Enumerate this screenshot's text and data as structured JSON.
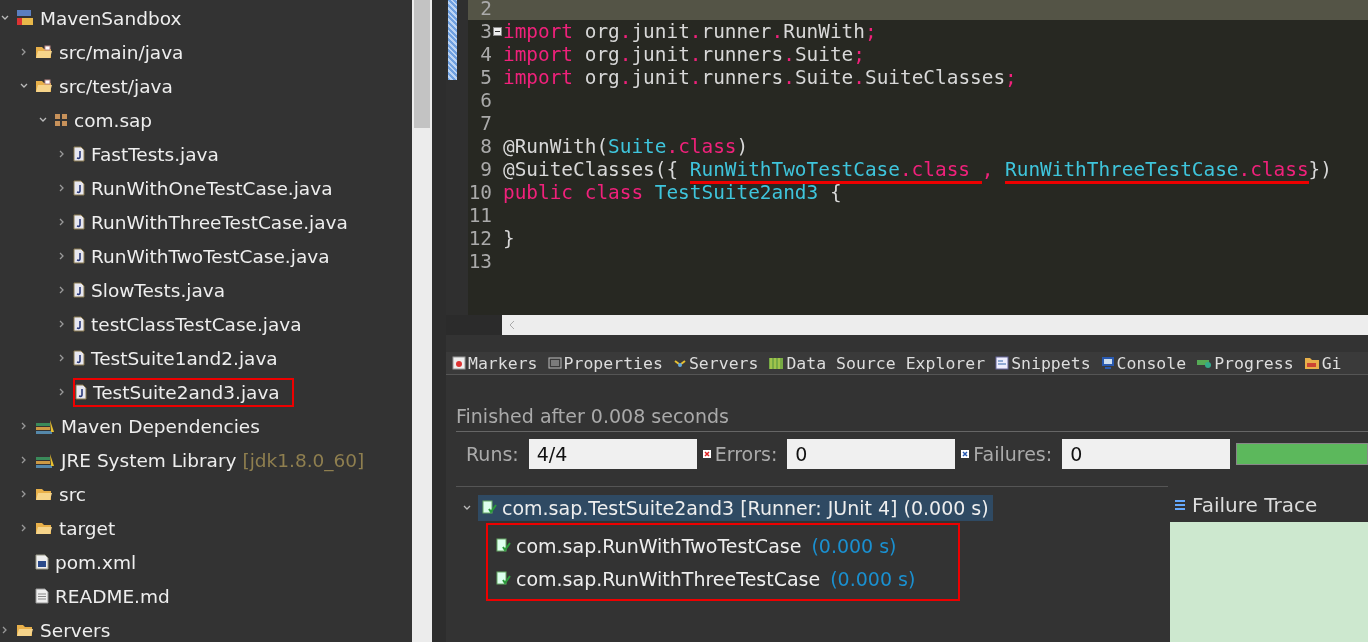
{
  "project_explorer": {
    "items": [
      {
        "label": "MavenSandbox",
        "kind": "project",
        "expanded": true,
        "children": [
          {
            "label": "src/main/java",
            "kind": "source-folder",
            "expanded": false
          },
          {
            "label": "src/test/java",
            "kind": "source-folder",
            "expanded": true,
            "children": [
              {
                "label": "com.sap",
                "kind": "package",
                "expanded": true,
                "children": [
                  {
                    "label": "FastTests.java",
                    "kind": "java-file",
                    "expanded": false,
                    "outlined": false
                  },
                  {
                    "label": "RunWithOneTestCase.java",
                    "kind": "java-file",
                    "expanded": false,
                    "outlined": false
                  },
                  {
                    "label": "RunWithThreeTestCase.java",
                    "kind": "java-file",
                    "expanded": false,
                    "outlined": false
                  },
                  {
                    "label": "RunWithTwoTestCase.java",
                    "kind": "java-file",
                    "expanded": false,
                    "outlined": false
                  },
                  {
                    "label": "SlowTests.java",
                    "kind": "java-file",
                    "expanded": false,
                    "outlined": false
                  },
                  {
                    "label": "testClassTestCase.java",
                    "kind": "java-file",
                    "expanded": false,
                    "outlined": false
                  },
                  {
                    "label": "TestSuite1and2.java",
                    "kind": "java-file",
                    "expanded": false,
                    "outlined": false
                  },
                  {
                    "label": "TestSuite2and3.java",
                    "kind": "java-file",
                    "expanded": false,
                    "outlined": true
                  }
                ]
              }
            ]
          },
          {
            "label": "Maven Dependencies",
            "kind": "library",
            "expanded": false
          },
          {
            "label": "JRE System Library",
            "decoration": "[jdk1.8.0_60]",
            "kind": "library",
            "expanded": false
          },
          {
            "label": "src",
            "kind": "folder",
            "expanded": false
          },
          {
            "label": "target",
            "kind": "folder",
            "expanded": false
          },
          {
            "label": "pom.xml",
            "kind": "xml-file"
          },
          {
            "label": "README.md",
            "kind": "text-file"
          }
        ]
      },
      {
        "label": "Servers",
        "kind": "folder",
        "expanded": false
      }
    ]
  },
  "editor": {
    "lines": [
      {
        "number": "2",
        "current": true
      },
      {
        "number": "3",
        "current": false,
        "folding": true,
        "tokens": [
          {
            "text": "import",
            "kind": "keyword"
          },
          {
            "text": " org",
            "kind": "plain"
          },
          {
            "text": ".",
            "kind": "punct"
          },
          {
            "text": "junit",
            "kind": "plain"
          },
          {
            "text": ".",
            "kind": "punct"
          },
          {
            "text": "runner",
            "kind": "plain"
          },
          {
            "text": ".",
            "kind": "punct"
          },
          {
            "text": "RunWith",
            "kind": "plain"
          },
          {
            "text": ";",
            "kind": "punct"
          }
        ]
      },
      {
        "number": "4",
        "current": false,
        "tokens": [
          {
            "text": "import",
            "kind": "keyword"
          },
          {
            "text": " org",
            "kind": "plain"
          },
          {
            "text": ".",
            "kind": "punct"
          },
          {
            "text": "junit",
            "kind": "plain"
          },
          {
            "text": ".",
            "kind": "punct"
          },
          {
            "text": "runners",
            "kind": "plain"
          },
          {
            "text": ".",
            "kind": "punct"
          },
          {
            "text": "Suite",
            "kind": "plain"
          },
          {
            "text": ";",
            "kind": "punct"
          }
        ]
      },
      {
        "number": "5",
        "current": false,
        "tokens": [
          {
            "text": "import",
            "kind": "keyword"
          },
          {
            "text": " org",
            "kind": "plain"
          },
          {
            "text": ".",
            "kind": "punct"
          },
          {
            "text": "junit",
            "kind": "plain"
          },
          {
            "text": ".",
            "kind": "punct"
          },
          {
            "text": "runners",
            "kind": "plain"
          },
          {
            "text": ".",
            "kind": "punct"
          },
          {
            "text": "Suite",
            "kind": "plain"
          },
          {
            "text": ".",
            "kind": "punct"
          },
          {
            "text": "SuiteClasses",
            "kind": "plain"
          },
          {
            "text": ";",
            "kind": "punct"
          }
        ]
      },
      {
        "number": "6",
        "current": false
      },
      {
        "number": "7",
        "current": false
      },
      {
        "number": "8",
        "current": false,
        "tokens": [
          {
            "text": "@RunWith(",
            "kind": "plain"
          },
          {
            "text": "Suite",
            "kind": "type"
          },
          {
            "text": ".class",
            "kind": "keyword"
          },
          {
            "text": ")",
            "kind": "plain"
          }
        ]
      },
      {
        "number": "9",
        "current": false,
        "tokens": [
          {
            "text": "@SuiteClasses({ ",
            "kind": "plain"
          },
          {
            "text": "RunWithTwoTestCase",
            "kind": "type",
            "underlined": true
          },
          {
            "text": ".class ",
            "kind": "keyword",
            "underlined": true
          },
          {
            "text": ", ",
            "kind": "punct"
          },
          {
            "text": "RunWithThreeTestCase",
            "kind": "type",
            "underlined": true
          },
          {
            "text": ".class",
            "kind": "keyword",
            "underlined": true
          },
          {
            "text": "})",
            "kind": "plain"
          }
        ]
      },
      {
        "number": "10",
        "current": false,
        "tokens": [
          {
            "text": "public class",
            "kind": "keyword"
          },
          {
            "text": " TestSuite2and3",
            "kind": "type"
          },
          {
            "text": " {",
            "kind": "plain"
          }
        ]
      },
      {
        "number": "11",
        "current": false
      },
      {
        "number": "12",
        "current": false,
        "tokens": [
          {
            "text": "}",
            "kind": "plain"
          }
        ]
      },
      {
        "number": "13",
        "current": false
      }
    ]
  },
  "view_tabs": [
    {
      "label": "Markers",
      "kind": "markers"
    },
    {
      "label": "Properties",
      "kind": "properties"
    },
    {
      "label": "Servers",
      "kind": "servers"
    },
    {
      "label": "Data Source Explorer",
      "kind": "data-source"
    },
    {
      "label": "Snippets",
      "kind": "snippets"
    },
    {
      "label": "Console",
      "kind": "console"
    },
    {
      "label": "Progress",
      "kind": "progress"
    },
    {
      "label": "Gi",
      "kind": "git"
    }
  ],
  "junit": {
    "status": "Finished after 0.008 seconds",
    "counters": [
      {
        "label": "Runs:",
        "value": "4/4",
        "kind": "runs"
      },
      {
        "label": "Errors:",
        "value": "0",
        "kind": "errors"
      },
      {
        "label": "Failures:",
        "value": "0",
        "kind": "failures"
      }
    ],
    "progress": {
      "level": 1
    },
    "results": [
      {
        "label": "com.sap.TestSuite2and3 [Runner: JUnit 4] (0.000 s)",
        "selected": true,
        "expanded": true,
        "children_outlined": true,
        "children": [
          {
            "label": "com.sap.RunWithTwoTestCase",
            "time": "(0.000 s)",
            "selected": false
          },
          {
            "label": "com.sap.RunWithThreeTestCase",
            "time": "(0.000 s)",
            "selected": false
          }
        ]
      }
    ],
    "failure_trace": {
      "title": "Failure Trace"
    }
  }
}
